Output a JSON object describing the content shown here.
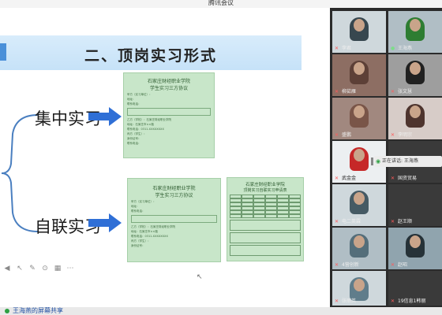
{
  "window": {
    "title": "腾讯会议"
  },
  "slide": {
    "title": "二、顶岗实习形式",
    "labels": [
      "集中实习",
      "自联实习"
    ],
    "doc1": {
      "title_line1": "石家庄财经职业学院",
      "title_line2": "学生实习三方协议",
      "lines": [
        "甲方（实习单位）：",
        "地址：",
        "联系电话：",
        "乙方（学校）：石家庄财经职业学院",
        "地址：石家庄市××路",
        "联系电话：0311-XXXXXXXX",
        "丙方（学生）：",
        "身份证号：",
        "联系电话："
      ]
    },
    "doc2": {
      "title_line1": "石家庄财经职业学院",
      "title_line2": "学生实习三方协议",
      "lines": [
        "甲方（实习单位）：",
        "地址：",
        "联系电话：",
        "乙方（学校）：石家庄财经职业学院",
        "地址：石家庄市××路",
        "联系电话：0311-XXXXXXXX",
        "丙方（学生）：",
        "身份证号："
      ]
    },
    "doc3": {
      "title_line1": "石家庄财经职业学院",
      "title_line2": "顶岗实习自联实习申请表"
    }
  },
  "toolbar": {
    "icons": [
      "back-icon",
      "pointer-icon",
      "pen-icon",
      "zoom-icon",
      "grid-icon",
      "more-icon"
    ]
  },
  "share_status": "王海燕的屏幕共享",
  "speaking": "正在讲话: 王海燕",
  "participants": [
    {
      "name": "李君",
      "muted": true
    },
    {
      "name": "王海燕",
      "muted": false
    },
    {
      "name": "柳茹雁",
      "muted": true
    },
    {
      "name": "张文慧",
      "muted": true
    },
    {
      "name": "盛鹏",
      "muted": true
    },
    {
      "name": "李明宗",
      "muted": true
    },
    {
      "name": "武金金",
      "muted": true
    },
    {
      "name": "国资贸易",
      "muted": true
    },
    {
      "name": "电二英霖",
      "muted": true
    },
    {
      "name": "赵王顺",
      "muted": true
    },
    {
      "name": "4营创新",
      "muted": true
    },
    {
      "name": "赵昭",
      "muted": true
    },
    {
      "name": "张丽英",
      "muted": true
    },
    {
      "name": "19信息1韩丽",
      "muted": true
    }
  ],
  "colors": {
    "accent": "#4a90d9",
    "doc_green": "#c8e6c9",
    "arrow_blue": "#2f6fd6",
    "speaking_green": "#2ea043"
  }
}
